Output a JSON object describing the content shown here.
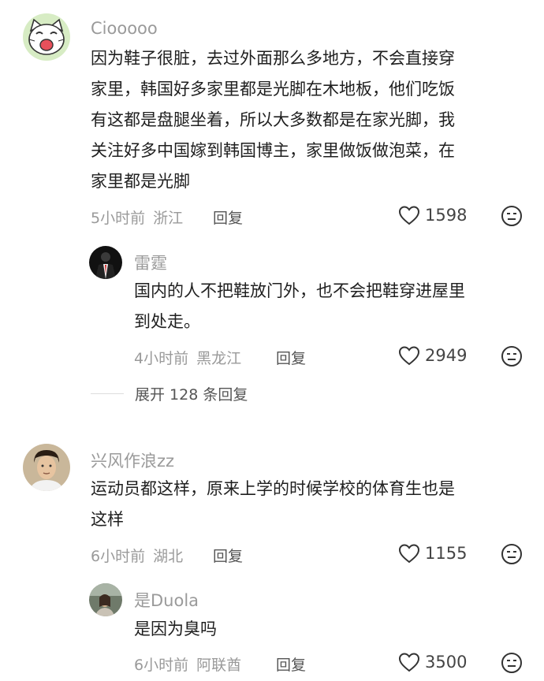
{
  "comments": [
    {
      "username": "Ciooooo",
      "lines": [
        "因为鞋子很脏，去过外面那么多地方，不会直接穿",
        "家里，韩国好多家里都是光脚在木地板，他们吃饭",
        "有这都是盘腿坐着，所以大多数都是在家光脚，我",
        "关注好多中国嫁到韩国博主，家里做饭做泡菜，在",
        "家里都是光脚"
      ],
      "time": "5小时前",
      "location": "浙江",
      "reply_label": "回复",
      "likes": "1598",
      "avatar_icon": "cartoon-cat-avatar"
    },
    {
      "username": "雷霆",
      "lines": [
        "国内的人不把鞋放门外，也不会把鞋穿进屋里",
        "到处走。"
      ],
      "time": "4小时前",
      "location": "黑龙江",
      "reply_label": "回复",
      "likes": "2949",
      "avatar_icon": "suit-figure-avatar"
    },
    {
      "username": "兴风作浪zz",
      "lines": [
        "运动员都这样，原来上学的时候学校的体育生也是",
        "这样"
      ],
      "time": "6小时前",
      "location": "湖北",
      "reply_label": "回复",
      "likes": "1155",
      "avatar_icon": "man-portrait-avatar"
    },
    {
      "username": "是Duola",
      "lines": [
        "是因为臭吗"
      ],
      "time": "6小时前",
      "location": "阿联酋",
      "reply_label": "回复",
      "likes": "3500",
      "avatar_icon": "photo-avatar"
    }
  ],
  "expand_replies": "展开 128 条回复",
  "colors": {
    "text": "#1f1f1f",
    "muted": "#9a9a9a",
    "action": "#555555"
  }
}
